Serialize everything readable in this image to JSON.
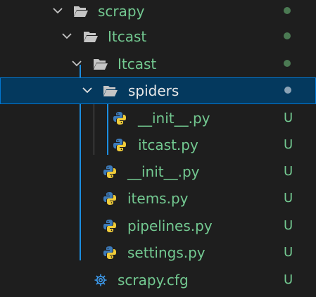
{
  "explorer": {
    "items": [
      {
        "label": "scrapy",
        "type": "folder",
        "expanded": true,
        "status": "dot"
      },
      {
        "label": "Itcast",
        "type": "folder",
        "expanded": true,
        "status": "dot"
      },
      {
        "label": "Itcast",
        "type": "folder",
        "expanded": true,
        "status": "dot"
      },
      {
        "label": "spiders",
        "type": "folder",
        "expanded": true,
        "selected": true,
        "status": "dot"
      },
      {
        "label": "__init__.py",
        "type": "python-file",
        "status": "U"
      },
      {
        "label": "itcast.py",
        "type": "python-file",
        "status": "U"
      },
      {
        "label": "__init__.py",
        "type": "python-file",
        "status": "U"
      },
      {
        "label": "items.py",
        "type": "python-file",
        "status": "U"
      },
      {
        "label": "pipelines.py",
        "type": "python-file",
        "status": "U"
      },
      {
        "label": "settings.py",
        "type": "python-file",
        "status": "U"
      },
      {
        "label": "scrapy.cfg",
        "type": "config-file",
        "status": "U"
      }
    ]
  },
  "colors": {
    "background": "#1e1e1e",
    "selection": "#04395e",
    "selection_border": "#0078d4",
    "untracked": "#73c991",
    "indent_guide_active": "#1c8ee0",
    "folder_icon": "#c5c5c5",
    "python_blue": "#3d7ab8",
    "python_yellow": "#f0cc3a",
    "gear_icon": "#3d9cf0"
  },
  "icons": {
    "chevron": "chevron-down-icon",
    "folder": "folder-open-icon",
    "python": "python-icon",
    "config": "gear-icon"
  }
}
